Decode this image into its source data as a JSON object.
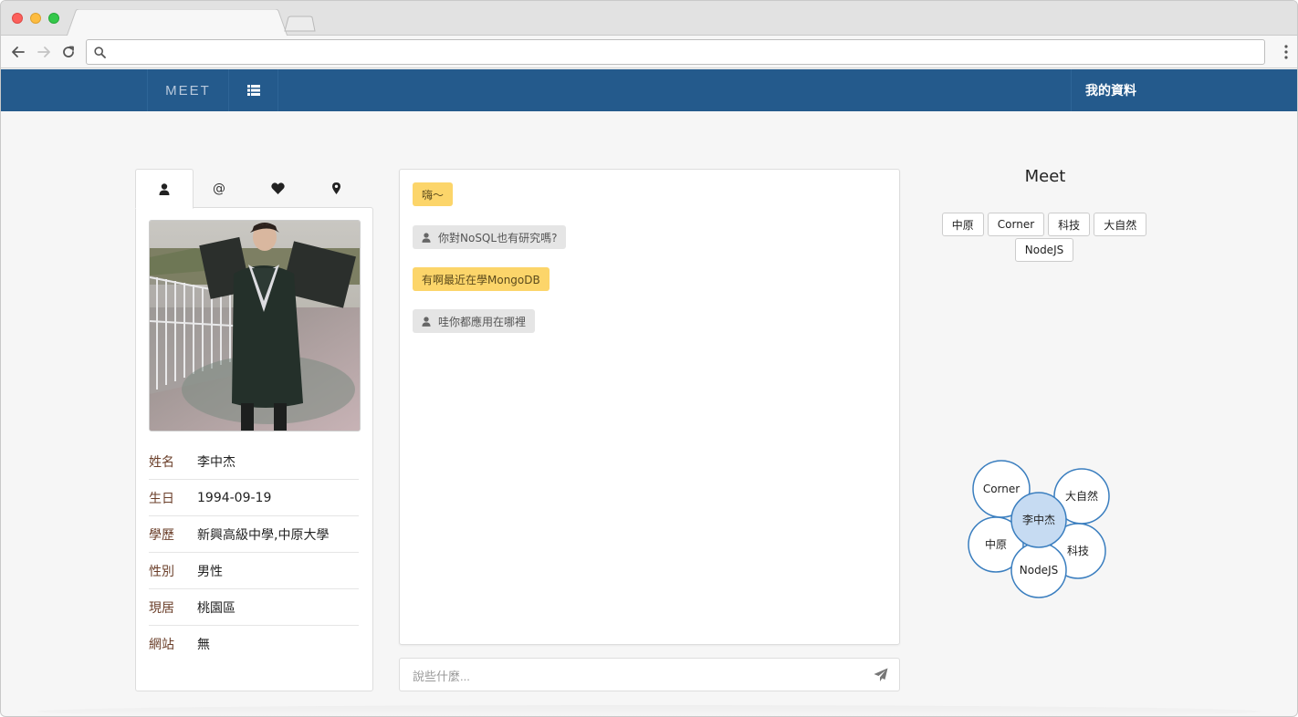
{
  "browser": {
    "tab_title": "",
    "address": ""
  },
  "navbar": {
    "brand": "MEET",
    "profile_link": "我的資料"
  },
  "profile": {
    "tabs": [
      {
        "icon": "user-icon"
      },
      {
        "label": "@"
      },
      {
        "icon": "heart-icon"
      },
      {
        "icon": "map-marker-icon"
      }
    ],
    "fields": [
      {
        "label": "姓名",
        "value": "李中杰"
      },
      {
        "label": "生日",
        "value": "1994-09-19"
      },
      {
        "label": "學歷",
        "value": "新興高級中學,中原大學"
      },
      {
        "label": "性別",
        "value": "男性"
      },
      {
        "label": "現居",
        "value": "桃園區"
      },
      {
        "label": "網站",
        "value": "無"
      }
    ]
  },
  "chat": {
    "messages": [
      {
        "from": "me",
        "text": "嗨～"
      },
      {
        "from": "other",
        "text": "你對NoSQL也有研究嗎?"
      },
      {
        "from": "me",
        "text": "有啊最近在學MongoDB"
      },
      {
        "from": "other",
        "text": "哇你都應用在哪裡"
      }
    ],
    "input_placeholder": "說些什麼..."
  },
  "meet": {
    "title": "Meet",
    "tags": [
      "中原",
      "Corner",
      "科技",
      "大自然",
      "NodeJS"
    ],
    "graph": {
      "center": "李中杰",
      "nodes": [
        "Corner",
        "大自然",
        "中原",
        "科技",
        "NodeJS"
      ]
    }
  },
  "colors": {
    "navbar": "#245a8c",
    "my_message": "#fcd56a",
    "other_message": "#e5e5e5",
    "graph_stroke": "#3a7ebf",
    "graph_center_fill": "#c6dbf2"
  }
}
